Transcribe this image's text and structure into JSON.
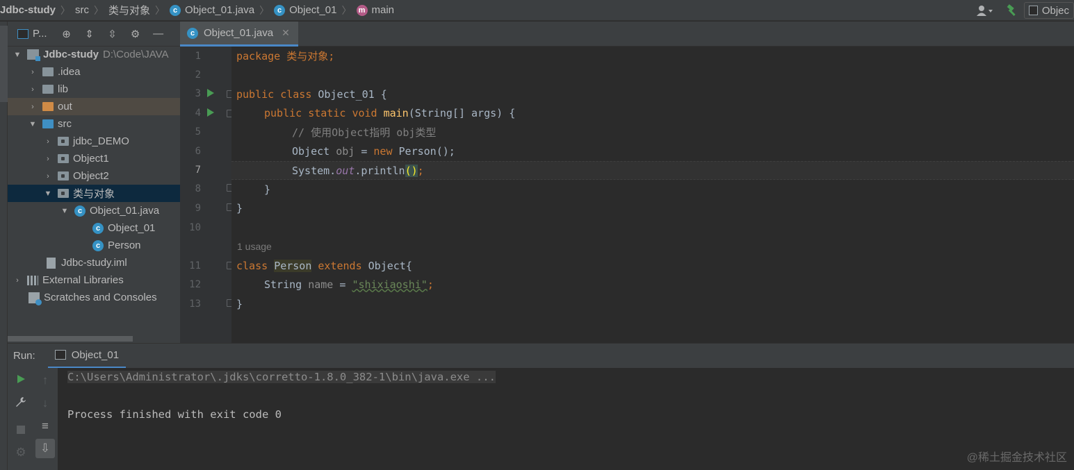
{
  "breadcrumbs": {
    "project": "Jdbc-study",
    "src": "src",
    "package": "类与对象",
    "file": "Object_01.java",
    "class": "Object_01",
    "method": "main"
  },
  "toolbar_right": {
    "run_config": "Objec"
  },
  "project_panel": {
    "title": "P...",
    "tree": [
      {
        "label": "Jdbc-study",
        "hint": "D:\\Code\\JAVA"
      },
      {
        "label": ".idea"
      },
      {
        "label": "lib"
      },
      {
        "label": "out"
      },
      {
        "label": "src"
      },
      {
        "label": "jdbc_DEMO"
      },
      {
        "label": "Object1"
      },
      {
        "label": "Object2"
      },
      {
        "label": "类与对象"
      },
      {
        "label": "Object_01.java"
      },
      {
        "label": "Object_01"
      },
      {
        "label": "Person"
      },
      {
        "label": "Jdbc-study.iml"
      },
      {
        "label": "External Libraries"
      },
      {
        "label": "Scratches and Consoles"
      }
    ]
  },
  "editor": {
    "tab_label": "Object_01.java",
    "line_numbers": [
      "1",
      "2",
      "3",
      "4",
      "5",
      "6",
      "7",
      "8",
      "9",
      "10",
      "11",
      "12",
      "13"
    ],
    "usage_hint": "1 usage",
    "tokens": {
      "package_kw": "package",
      "package_name": " 类与对象;",
      "public": "public",
      "class": "class",
      "static": "static",
      "void": "void",
      "new": "new",
      "extends": "extends",
      "class_name": " Object_01 {",
      "main": "main",
      "main_args": "(String[] args) {",
      "comment": "// 使用Object指明 obj类型",
      "obj_type": "Object ",
      "obj_var": "obj",
      "assign": " = ",
      "person_ctor": " Person();",
      "system": "System.",
      "out": "out",
      "println": ".println",
      "parens": "()",
      "semi": ";",
      "close_brace": "}",
      "person_class": "Person",
      "object_brace": " Object{",
      "string_type": "String ",
      "name_var": "name",
      "string_val": "\"shixiaoshi\"",
      "space": " "
    }
  },
  "run_panel": {
    "label": "Run:",
    "tab": "Object_01",
    "command": "C:\\Users\\Administrator\\.jdks\\corretto-1.8.0_382-1\\bin\\java.exe ...",
    "result": "Process finished with exit code 0"
  },
  "watermark": "@稀土掘金技术社区"
}
